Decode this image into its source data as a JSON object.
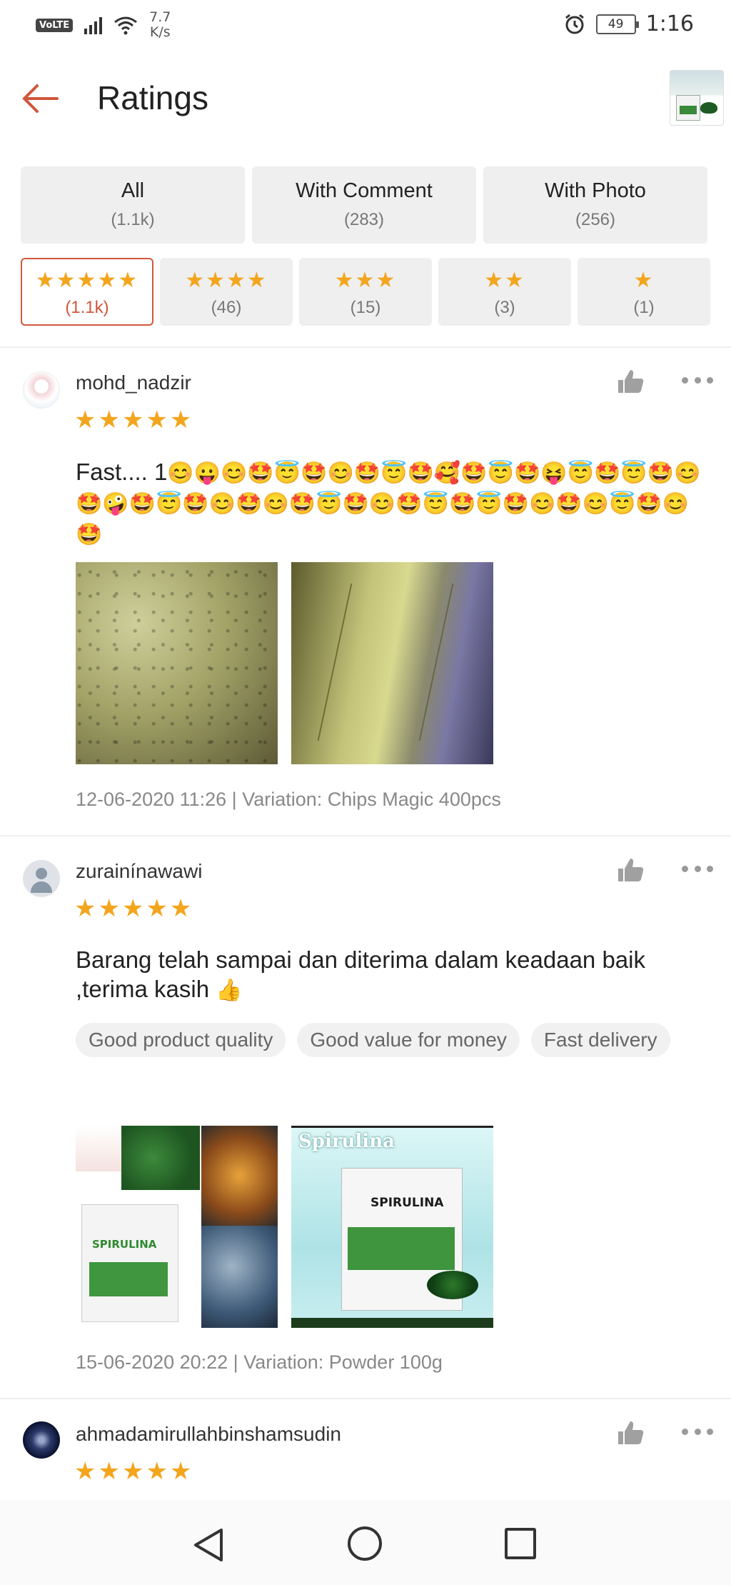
{
  "status_bar": {
    "volte": "VoLTE",
    "net_speed_value": "7.7",
    "net_speed_unit": "K/s",
    "battery": "49",
    "time": "1:16"
  },
  "header": {
    "title": "Ratings",
    "back_icon": "arrow-left-icon"
  },
  "filters": {
    "tabs": [
      {
        "label": "All",
        "count": "(1.1k)"
      },
      {
        "label": "With Comment",
        "count": "(283)"
      },
      {
        "label": "With Photo",
        "count": "(256)"
      }
    ],
    "star_tabs": [
      {
        "stars": "★★★★★",
        "count": "(1.1k)",
        "active": true
      },
      {
        "stars": "★★★★",
        "count": "(46)",
        "active": false
      },
      {
        "stars": "★★★",
        "count": "(15)",
        "active": false
      },
      {
        "stars": "★★",
        "count": "(3)",
        "active": false
      },
      {
        "stars": "★",
        "count": "(1)",
        "active": false
      }
    ]
  },
  "reviews": [
    {
      "username": "mohd_nadzir",
      "rating": 5,
      "stars": "★★★★★",
      "comment_text": "Fast.... 1",
      "comment_emojis": "😊😛😊🤩😇🤩😊🤩😇🤩🥰🤩😇🤩😝😇🤩😇🤩😊🤩🤪🤩😇🤩😊🤩😊🤩😇🤩😊🤩😇🤩😇🤩😊🤩😊😇🤩😊🤩",
      "meta": "12-06-2020 11:26 | Variation: Chips Magic 400pcs"
    },
    {
      "username": "zurainínawawi",
      "rating": 5,
      "stars": "★★★★★",
      "comment_text": "Barang telah sampai dan diterima dalam keadaan baik ,terima kasih",
      "comment_emojis": "👍",
      "tags": [
        "Good product quality",
        "Good value for money",
        "Fast delivery"
      ],
      "photo2_title": "Spirulina",
      "photo_pack_label": "SPIRULINA",
      "meta": "15-06-2020 20:22 | Variation: Powder 100g"
    },
    {
      "username": "ahmadamirullahbinshamsudin",
      "rating": 5,
      "stars": "★★★★★"
    }
  ],
  "icons": {
    "like": "thumbs-up-icon",
    "more": "more-dots-icon"
  },
  "colors": {
    "accent": "#d0573c",
    "star": "#f3a51d"
  }
}
